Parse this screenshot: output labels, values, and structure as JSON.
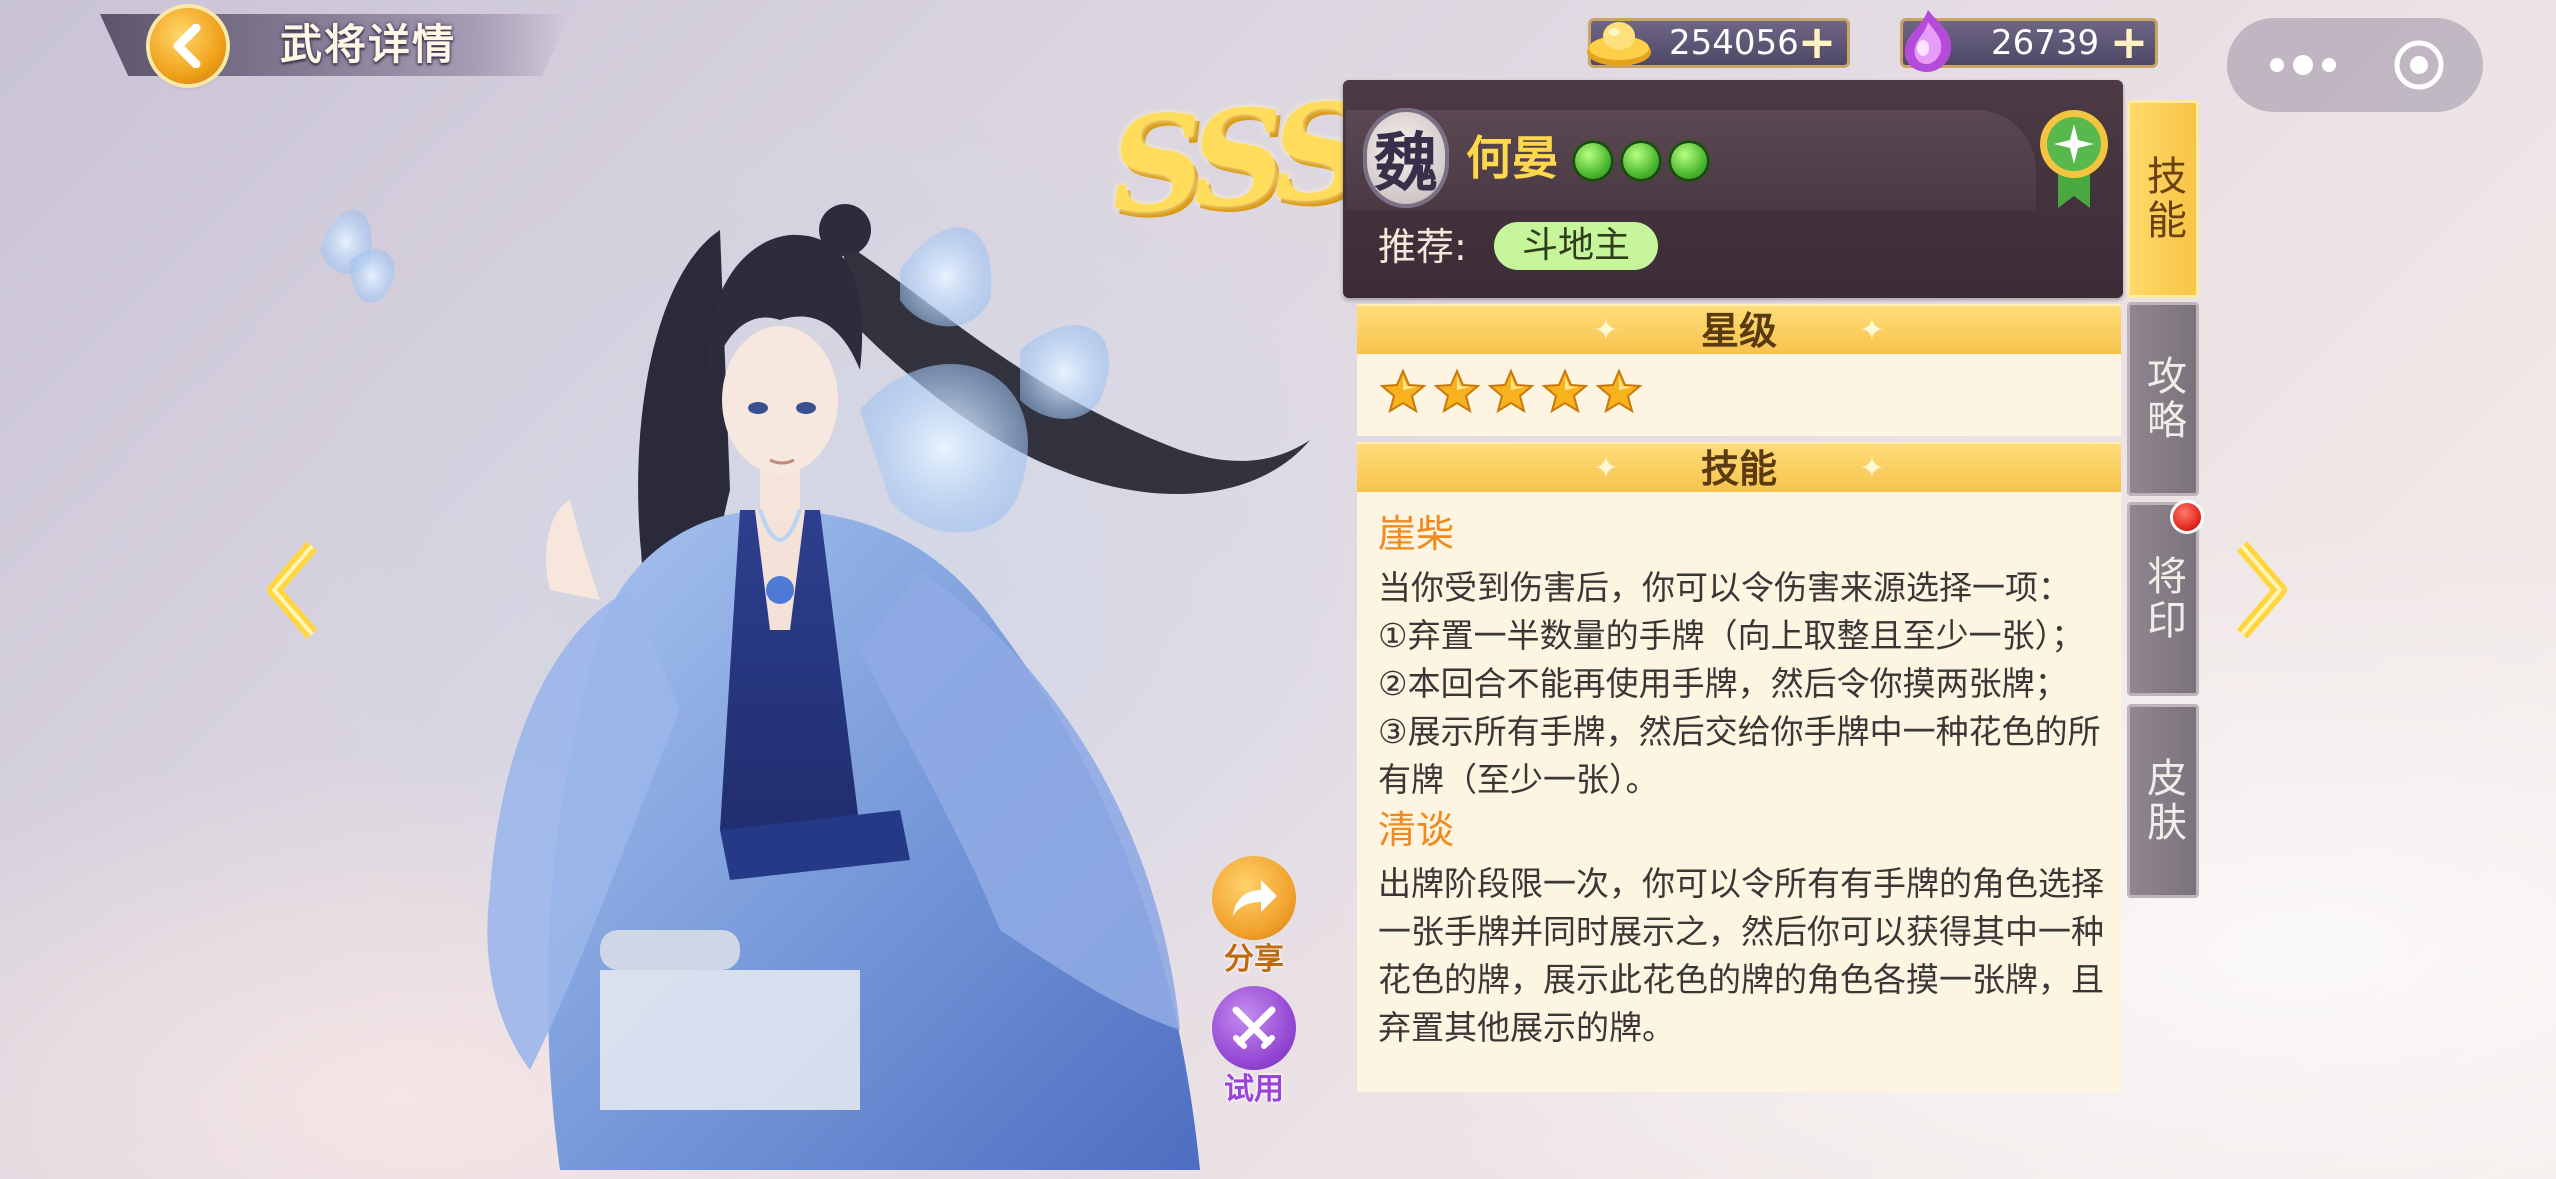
{
  "header": {
    "title": "武将详情"
  },
  "currencies": {
    "gold": "254056",
    "gem": "26739",
    "plus": "+"
  },
  "hero": {
    "rank": "SSS",
    "kingdom": "魏",
    "name": "何晏",
    "recommend_label": "推荐:",
    "recommend_mode": "斗地主"
  },
  "stars_section": {
    "title": "星级",
    "star_count": 5
  },
  "skills_section": {
    "title": "技能",
    "skills": [
      {
        "name": "崖柴",
        "description": "当你受到伤害后，你可以令伤害来源选择一项：\n①弃置一半数量的手牌（向上取整且至少一张）；\n②本回合不能再使用手牌，然后令你摸两张牌；\n③展示所有手牌，然后交给你手牌中一种花色的所\n有牌（至少一张）。"
      },
      {
        "name": "清谈",
        "description": "出牌阶段限一次，你可以令所有有手牌的角色选择\n一张手牌并同时展示之，然后你可以获得其中一种\n花色的牌，展示此花色的牌的角色各摸一张牌，且\n弃置其他展示的牌。"
      }
    ]
  },
  "actions": {
    "share": "分享",
    "try": "试用"
  },
  "tabs": [
    {
      "label": "技能",
      "active": true
    },
    {
      "label": "攻略",
      "active": false
    },
    {
      "label": "将印",
      "active": false,
      "notification": true
    },
    {
      "label": "皮肤",
      "active": false
    }
  ],
  "colors": {
    "accent_gold": "#f7c445",
    "skill_name": "#f08a1e",
    "panel_dark": "#3b2c36",
    "panel_light": "#fdf5e2"
  }
}
